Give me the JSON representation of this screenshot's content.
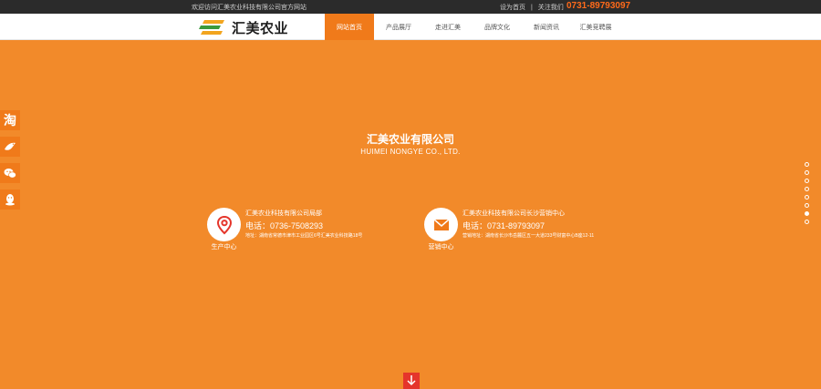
{
  "topbar": {
    "welcome": "欢迎访问汇美农业科技有限公司官方网站",
    "links": [
      "设为首页",
      "|",
      "关注我们"
    ],
    "phone": "0731-89793097"
  },
  "header": {
    "logo_text": "汇美农业",
    "nav": [
      "网站首页",
      "产品展厅",
      "走进汇美",
      "品牌文化",
      "新闻资讯",
      "汇美竞聘展"
    ]
  },
  "side_icons": [
    "taobao-icon",
    "bird-icon",
    "wechat-icon",
    "qq-icon"
  ],
  "company": {
    "name": "汇美农业有限公司",
    "en": "HUIMEI NONGYE CO., LTD."
  },
  "cards": [
    {
      "caption": "生产中心",
      "title": "汇美农业科技有限公司局部",
      "tel": "电话：0736-7508293",
      "addr": "地址：湖南省常德市津市工业园区6号汇美农业科技路18号"
    },
    {
      "caption": "营销中心",
      "title": "汇美农业科技有限公司长沙营销中心",
      "tel": "电话：0731-89793097",
      "addr": "营销地址：湖南省长沙市岳麓区五一大道233号财富中心B座12-11"
    }
  ],
  "pager": {
    "count": 8,
    "active_index": 6
  },
  "colors": {
    "brand_orange": "#f28a2a",
    "nav_active": "#f07a1a",
    "phone": "#ff6a1a",
    "down_button": "#e5352b"
  }
}
